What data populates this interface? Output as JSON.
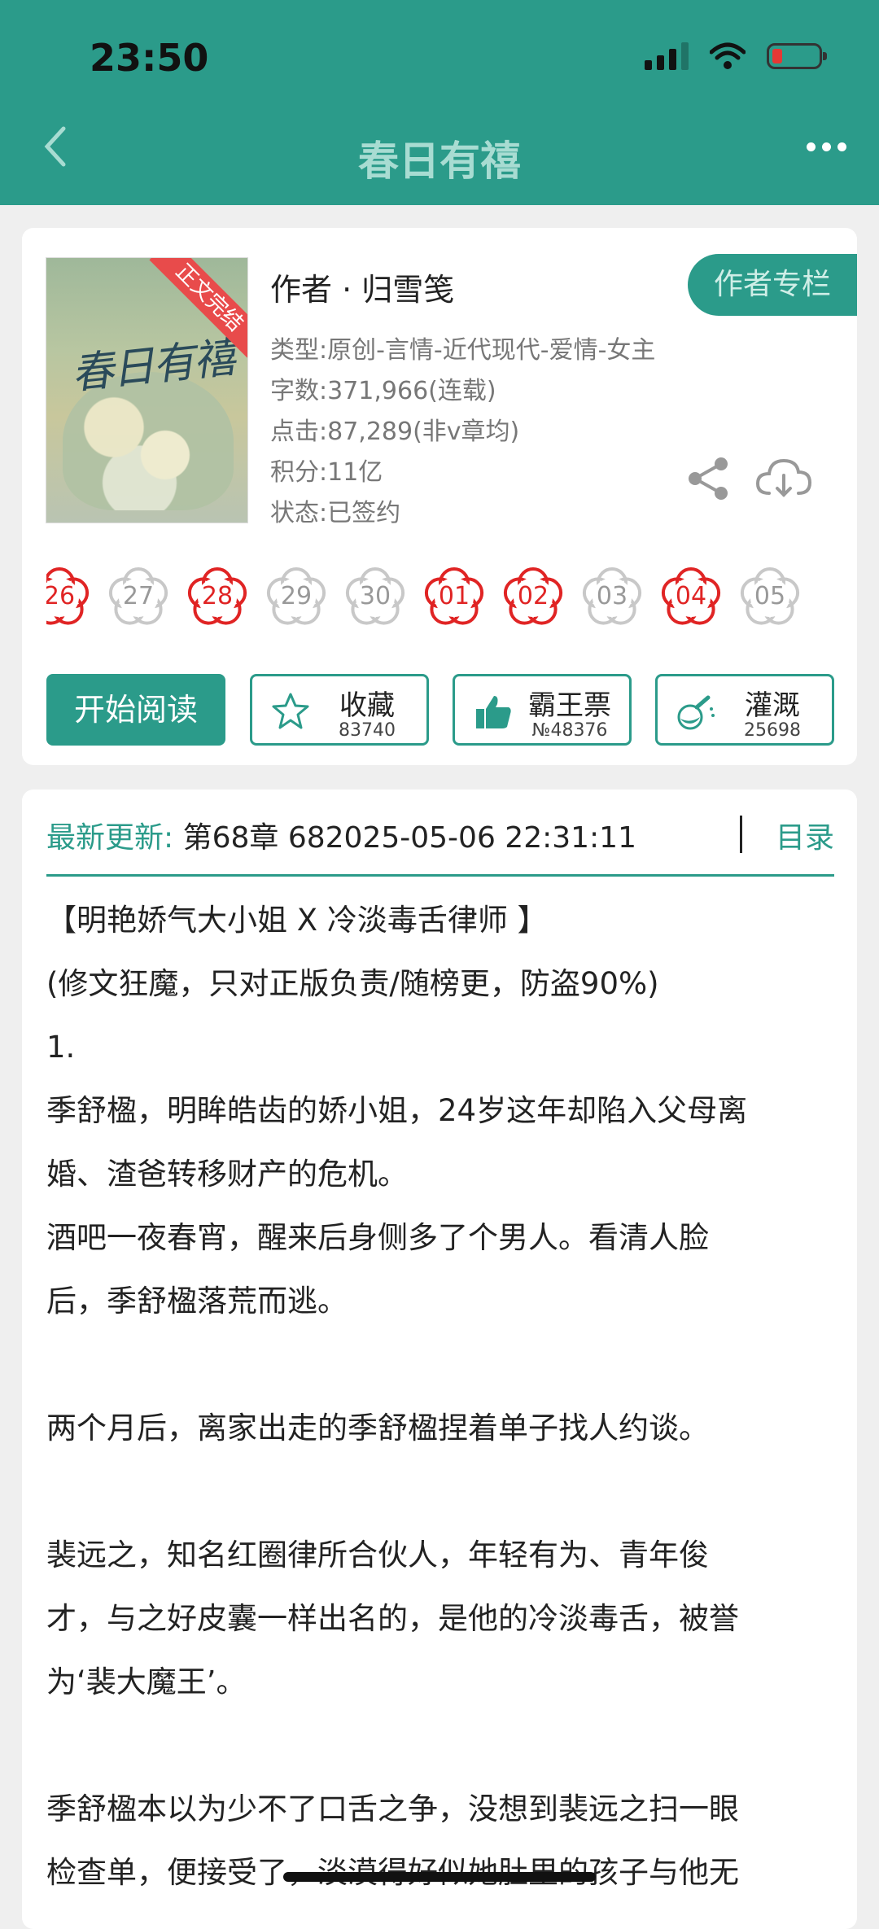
{
  "status_bar": {
    "time": "23:50"
  },
  "nav": {
    "title": "春日有禧"
  },
  "book": {
    "cover_title": "春日有禧",
    "cover_ribbon": "正文完结",
    "author": "作者 · 归雪笺",
    "author_column_button": "作者专栏",
    "type": "类型:原创-言情-近代现代-爱情-女主",
    "word_count": "字数:371,966(连载)",
    "clicks": "点击:87,289(非v章均)",
    "score": "积分:11亿",
    "status": "状态:已签约"
  },
  "tickets": [
    {
      "num": "26",
      "active": true
    },
    {
      "num": "27",
      "active": false
    },
    {
      "num": "28",
      "active": true
    },
    {
      "num": "29",
      "active": false
    },
    {
      "num": "30",
      "active": false
    },
    {
      "num": "01",
      "active": true
    },
    {
      "num": "02",
      "active": true
    },
    {
      "num": "03",
      "active": false
    },
    {
      "num": "04",
      "active": true
    },
    {
      "num": "05",
      "active": false
    }
  ],
  "actions": {
    "read": "开始阅读",
    "favorite": {
      "label": "收藏",
      "count": "83740"
    },
    "bawang": {
      "label": "霸王票",
      "count": "№48376"
    },
    "irrigate": {
      "label": "灌溉",
      "count": "25698"
    }
  },
  "latest": {
    "label": "最新更新:",
    "text": " 第68章 682025-05-06 22:31:11",
    "toc": "目录"
  },
  "description": [
    "【明艳娇气大小姐 X 冷淡毒舌律师 】",
    "(修文狂魔，只对正版负责/随榜更，防盗90%)",
    "1.",
    "季舒楹，明眸皓齿的娇小姐，24岁这年却陷入父母离",
    "婚、渣爸转移财产的危机。",
    "酒吧一夜春宵，醒来后身侧多了个男人。看清人脸",
    "后，季舒楹落荒而逃。",
    "",
    "两个月后，离家出走的季舒楹捏着单子找人约谈。",
    "",
    "裴远之，知名红圈律所合伙人，年轻有为、青年俊",
    "才，与之好皮囊一样出名的，是他的冷淡毒舌，被誉",
    "为‘裴大魔王’。",
    "",
    "季舒楹本以为少不了口舌之争，没想到裴远之扫一眼",
    "检查单，便接受了，淡漠得好似她肚里的孩子与他无"
  ],
  "colors": {
    "primary": "#2b9b8a",
    "ticket_red": "#e02424",
    "ticket_gray": "#c8c8c8"
  }
}
